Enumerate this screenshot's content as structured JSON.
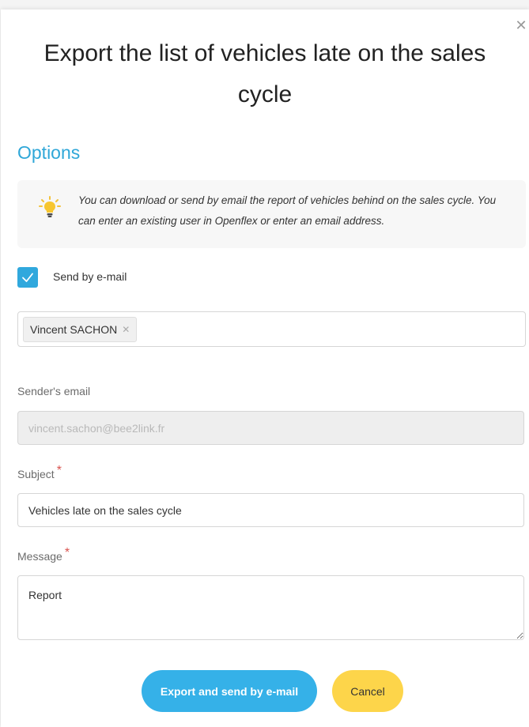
{
  "dialog": {
    "title": "Export the list of vehicles late on the sales cycle",
    "close_icon": "close-icon"
  },
  "options": {
    "section_title": "Options",
    "info_icon": "lightbulb-icon",
    "info_text": "You can download or send by email the report of vehicles behind on the sales cycle. You can enter an existing user in Openflex or enter an email address.",
    "send_by_email_label": "Send by e-mail",
    "send_by_email_checked": true
  },
  "recipients": [
    {
      "name": "Vincent SACHON"
    }
  ],
  "sender": {
    "label": "Sender's email",
    "value": "vincent.sachon@bee2link.fr"
  },
  "subject": {
    "label": "Subject",
    "required_mark": "*",
    "value": "Vehicles late on the sales cycle"
  },
  "message": {
    "label": "Message",
    "required_mark": "*",
    "value": "Report"
  },
  "actions": {
    "export_label": "Export and send by e-mail",
    "cancel_label": "Cancel"
  },
  "colors": {
    "accent": "#2fa7d8",
    "primary_button": "#35b1e8",
    "cancel_button": "#fdd54a",
    "required": "#d9534f"
  }
}
